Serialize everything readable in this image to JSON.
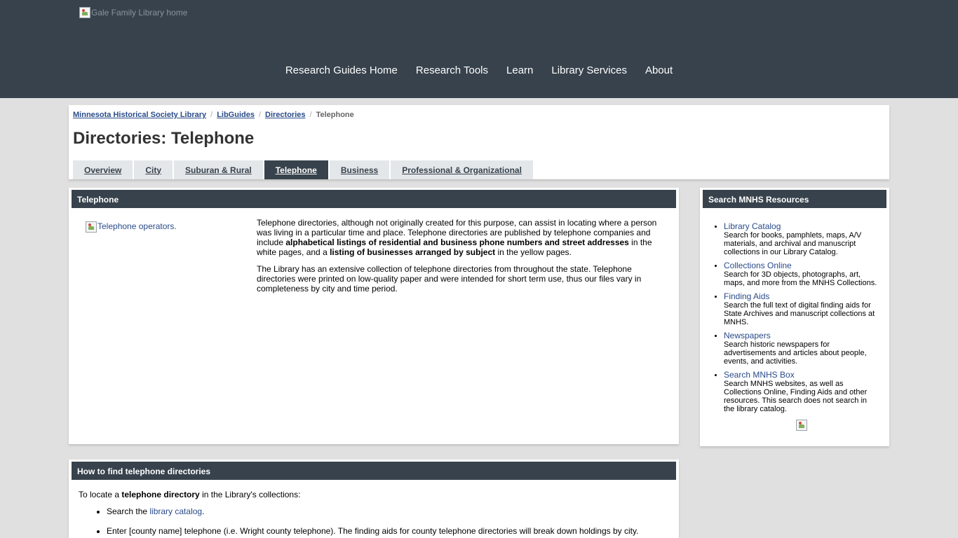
{
  "header": {
    "logo_alt": "Gale Family Library home",
    "nav": [
      "Research Guides Home",
      "Research Tools",
      "Learn",
      "Library Services",
      "About"
    ]
  },
  "breadcrumb": [
    "Minnesota Historical Society Library",
    "LibGuides",
    "Directories",
    "Telephone"
  ],
  "page_title": "Directories: Telephone",
  "tabs": [
    "Overview",
    "City",
    "Suburan & Rural",
    "Telephone",
    "Business",
    "Professional & Organizational"
  ],
  "active_tab": "Telephone",
  "telephone_box": {
    "heading": "Telephone",
    "image_alt": "Telephone operators.",
    "p1_a": "Telephone directories, although not originally created for this purpose, can assist in locating where a person was living in a particular time and place. Telephone directories are published by telephone companies and include ",
    "p1_b": "alphabetical listings of residential and business phone numbers and street addresses",
    "p1_c": " in the white pages, and a ",
    "p1_d": "listing of businesses arranged by subject",
    "p1_e": " in the yellow pages.",
    "p2": "The Library has an extensive collection of telephone directories from throughout the state.  Telephone directories were printed on low-quality paper and were intended for short term use, thus our files vary in completeness by city and time period."
  },
  "how_box": {
    "heading": "How to find telephone directories",
    "intro_a": "To locate a ",
    "intro_b": "telephone directory",
    "intro_c": " in the Library's collections:",
    "item1_a": "Search the ",
    "item1_link": "library catalog",
    "item1_b": ".",
    "item2": "Enter [county name] telephone (i.e. Wright county telephone). The finding aids for county telephone directories will break down holdings by city."
  },
  "sidebar": {
    "heading": "Search MNHS Resources",
    "items": [
      {
        "label": "Library Catalog",
        "desc": "Search for books, pamphlets, maps, A/V materials, and archival and manuscript collections in our Library Catalog."
      },
      {
        "label": "Collections Online",
        "desc": "Search for 3D objects, photographs, art, maps, and more from the MNHS Collections."
      },
      {
        "label": "Finding Aids",
        "desc": "Search the full text of digital finding aids for State Archives and manuscript collections at MNHS."
      },
      {
        "label": "Newspapers",
        "desc": "Search historic newspapers for advertisements and articles about people, events, and activities."
      },
      {
        "label": "Search MNHS Box",
        "desc": "Search MNHS websites, as well as Collections Online, Finding Aids and other resources. This search does not search in the library catalog."
      }
    ]
  },
  "colors": {
    "header_bg": "#37424c",
    "link": "#2a4b8a",
    "page_bg": "#e0e0e0"
  }
}
